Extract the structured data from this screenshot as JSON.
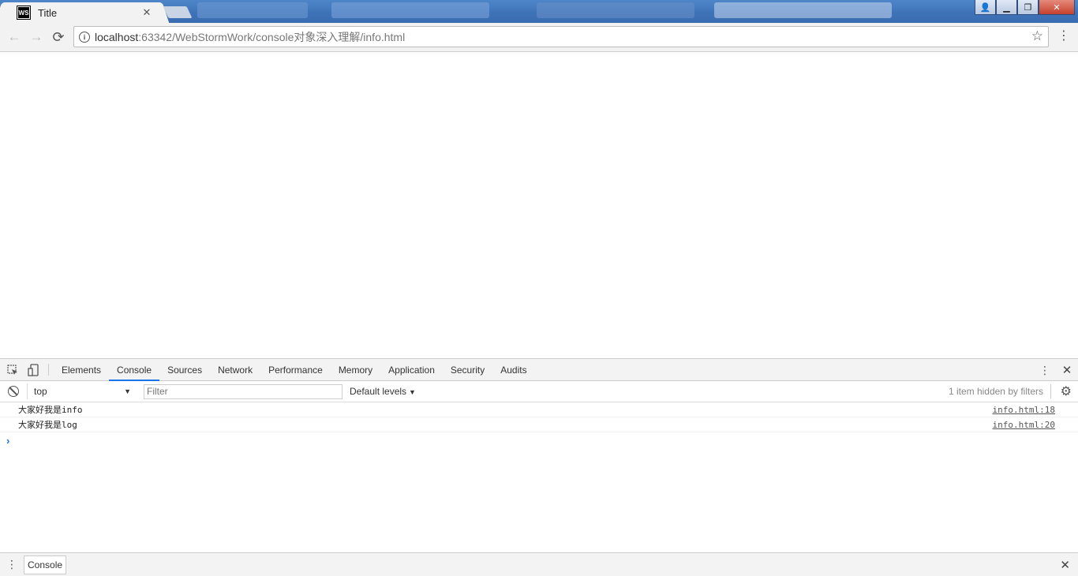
{
  "browser": {
    "tab": {
      "favicon_text": "WS",
      "title": "Title",
      "close_glyph": "✕"
    },
    "window_buttons": {
      "user": "👤",
      "minimize": "▁",
      "restore": "❐",
      "close": "✕"
    },
    "toolbar": {
      "back": "←",
      "forward": "→",
      "reload": "⟳",
      "url_host": "localhost",
      "url_rest": ":63342/WebStormWork/console对象深入理解/info.html",
      "star": "☆",
      "menu": "⋮"
    }
  },
  "devtools": {
    "tabs": [
      "Elements",
      "Console",
      "Sources",
      "Network",
      "Performance",
      "Memory",
      "Application",
      "Security",
      "Audits"
    ],
    "active_tab": "Console",
    "filterbar": {
      "context": "top",
      "filter_placeholder": "Filter",
      "levels": "Default levels",
      "hidden_note": "1 item hidden by filters"
    },
    "logs": [
      {
        "message": "大家好我是info",
        "source": "info.html:18"
      },
      {
        "message": "大家好我是log",
        "source": "info.html:20"
      }
    ],
    "prompt": "›",
    "drawer_tab": "Console"
  },
  "colors": {
    "accent": "#1a73e8",
    "titlebar": "#3f73b8",
    "close_red": "#c6402c"
  }
}
